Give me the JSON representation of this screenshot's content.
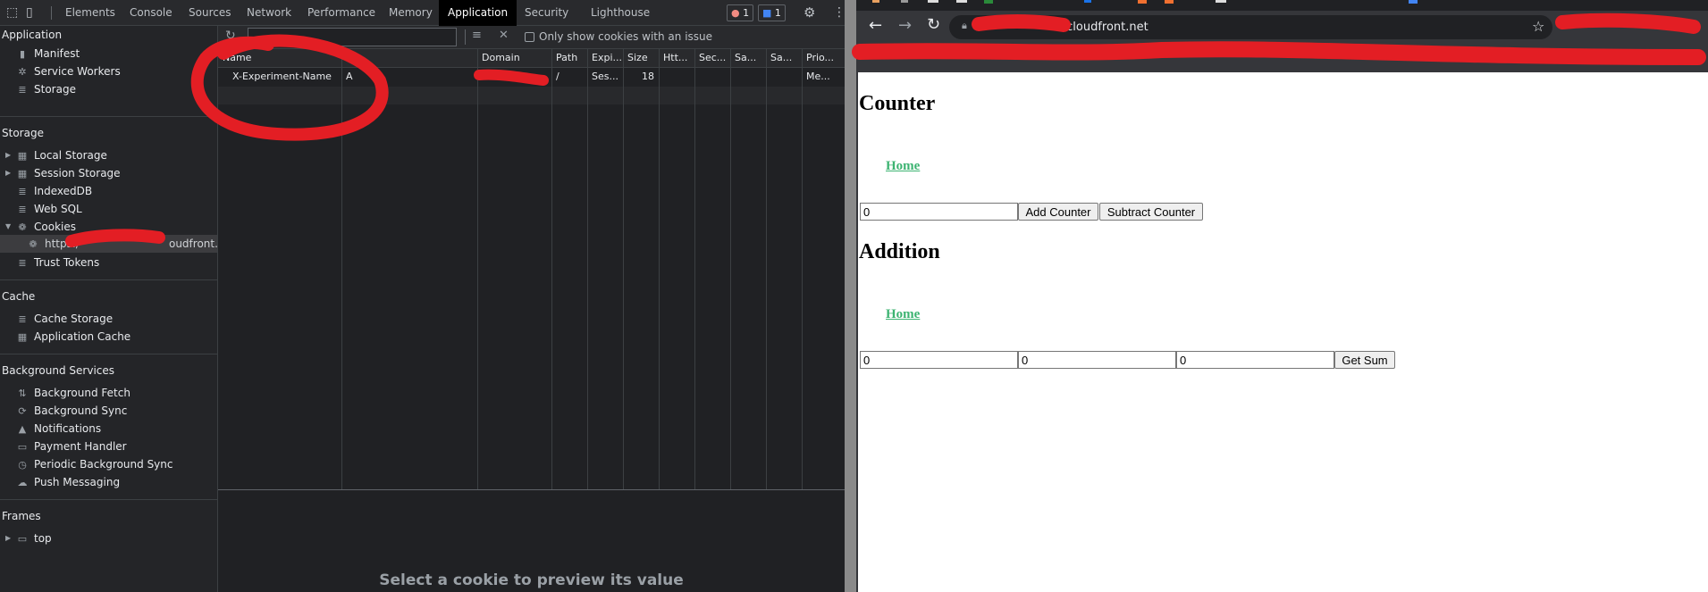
{
  "devtools": {
    "tabs": [
      "Elements",
      "Console",
      "Sources",
      "Network",
      "Performance",
      "Memory",
      "Application",
      "Security",
      "Lighthouse"
    ],
    "active_tab": "Application",
    "error_count": "1",
    "message_count": "1",
    "sidebar": {
      "application": {
        "header": "Application",
        "items": [
          "Manifest",
          "Service Workers",
          "Storage"
        ]
      },
      "storage": {
        "header": "Storage",
        "items": [
          "Local Storage",
          "Session Storage",
          "IndexedDB",
          "Web SQL",
          "Cookies",
          "Trust Tokens"
        ],
        "cookie_origin": "https:/",
        "cookie_origin_suffix": "oudfront.ne"
      },
      "cache": {
        "header": "Cache",
        "items": [
          "Cache Storage",
          "Application Cache"
        ]
      },
      "background": {
        "header": "Background Services",
        "items": [
          "Background Fetch",
          "Background Sync",
          "Notifications",
          "Payment Handler",
          "Periodic Background Sync",
          "Push Messaging"
        ]
      },
      "frames": {
        "header": "Frames",
        "items": [
          "top"
        ]
      }
    },
    "toolbar": {
      "filter_placeholder": "",
      "only_issues_label": "Only show cookies with an issue",
      "only_issues_checked": false
    },
    "table": {
      "columns": [
        "Name",
        "",
        "Domain",
        "Path",
        "Expi...",
        "Size",
        "Htt...",
        "Sec...",
        "Sa...",
        "Sa...",
        "Prio..."
      ],
      "rows": [
        {
          "name": "X-Experiment-Name",
          "value": "A",
          "domain": "",
          "path": "/",
          "expires": "Ses...",
          "size": "18",
          "http": "",
          "secure": "",
          "samesite": "",
          "sameparty": "",
          "priority": "Me..."
        }
      ]
    },
    "preview_message": "Select a cookie to preview its value"
  },
  "browser": {
    "url": ".cloudfront.net",
    "page": {
      "counter_heading": "Counter",
      "home_link": "Home",
      "counter_value": "0",
      "add_counter": "Add Counter",
      "subtract_counter": "Subtract Counter",
      "addition_heading": "Addition",
      "addend_a": "0",
      "addend_b": "0",
      "sum": "0",
      "get_sum": "Get Sum"
    }
  },
  "colors": {
    "annotation_red": "#e31e24",
    "link_green": "#3cb371",
    "devtools_bg": "#202124"
  }
}
